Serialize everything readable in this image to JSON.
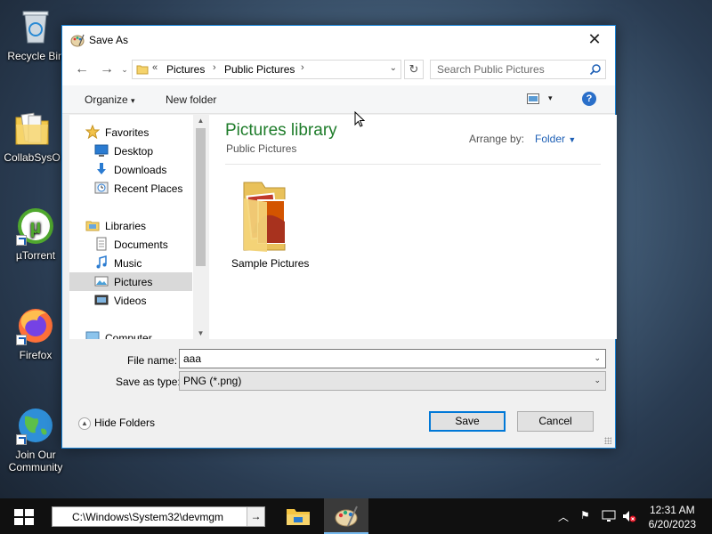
{
  "desktop": {
    "icons": [
      {
        "label": "Recycle Bin",
        "icon": "recycle-bin-icon"
      },
      {
        "label": "CollabSysO",
        "icon": "folder-documents-icon"
      },
      {
        "label": "µTorrent",
        "icon": "utorrent-icon"
      },
      {
        "label": "Firefox",
        "icon": "firefox-icon"
      },
      {
        "label": "Join Our Community",
        "icon": "globe-icon"
      }
    ]
  },
  "dialog": {
    "title": "Save As",
    "address": {
      "prefix": "«",
      "crumbs": [
        "Pictures",
        "Public Pictures"
      ]
    },
    "search_placeholder": "Search Public Pictures",
    "toolbar": {
      "organize": "Organize",
      "new_folder": "New folder"
    },
    "sidebar": {
      "items": [
        {
          "label": "Favorites",
          "icon": "star-icon"
        },
        {
          "label": "Desktop",
          "icon": "desktop-icon"
        },
        {
          "label": "Downloads",
          "icon": "downloads-icon"
        },
        {
          "label": "Recent Places",
          "icon": "recent-places-icon"
        },
        {
          "label": "Libraries",
          "icon": "libraries-icon"
        },
        {
          "label": "Documents",
          "icon": "documents-icon"
        },
        {
          "label": "Music",
          "icon": "music-icon"
        },
        {
          "label": "Pictures",
          "icon": "pictures-icon",
          "selected": true
        },
        {
          "label": "Videos",
          "icon": "videos-icon"
        },
        {
          "label": "Computer",
          "icon": "computer-icon"
        }
      ]
    },
    "content": {
      "library_title": "Pictures library",
      "library_subtitle": "Public Pictures",
      "arrange_label": "Arrange by:",
      "arrange_value": "Folder",
      "items": [
        {
          "label": "Sample Pictures",
          "icon": "pictures-folder-icon"
        }
      ]
    },
    "file_name_label": "File name:",
    "file_name_value": "aaa",
    "save_type_label": "Save as type:",
    "save_type_value": "PNG (*.png)",
    "hide_folders": "Hide Folders",
    "save_button": "Save",
    "cancel_button": "Cancel"
  },
  "taskbar": {
    "run_value": "C:\\Windows\\System32\\devmgm",
    "go_label": "→",
    "clock_time": "12:31 AM",
    "clock_date": "6/20/2023"
  },
  "colors": {
    "accent": "#0078d7",
    "library_title": "#1e7c2a",
    "link": "#1d5fb5"
  }
}
